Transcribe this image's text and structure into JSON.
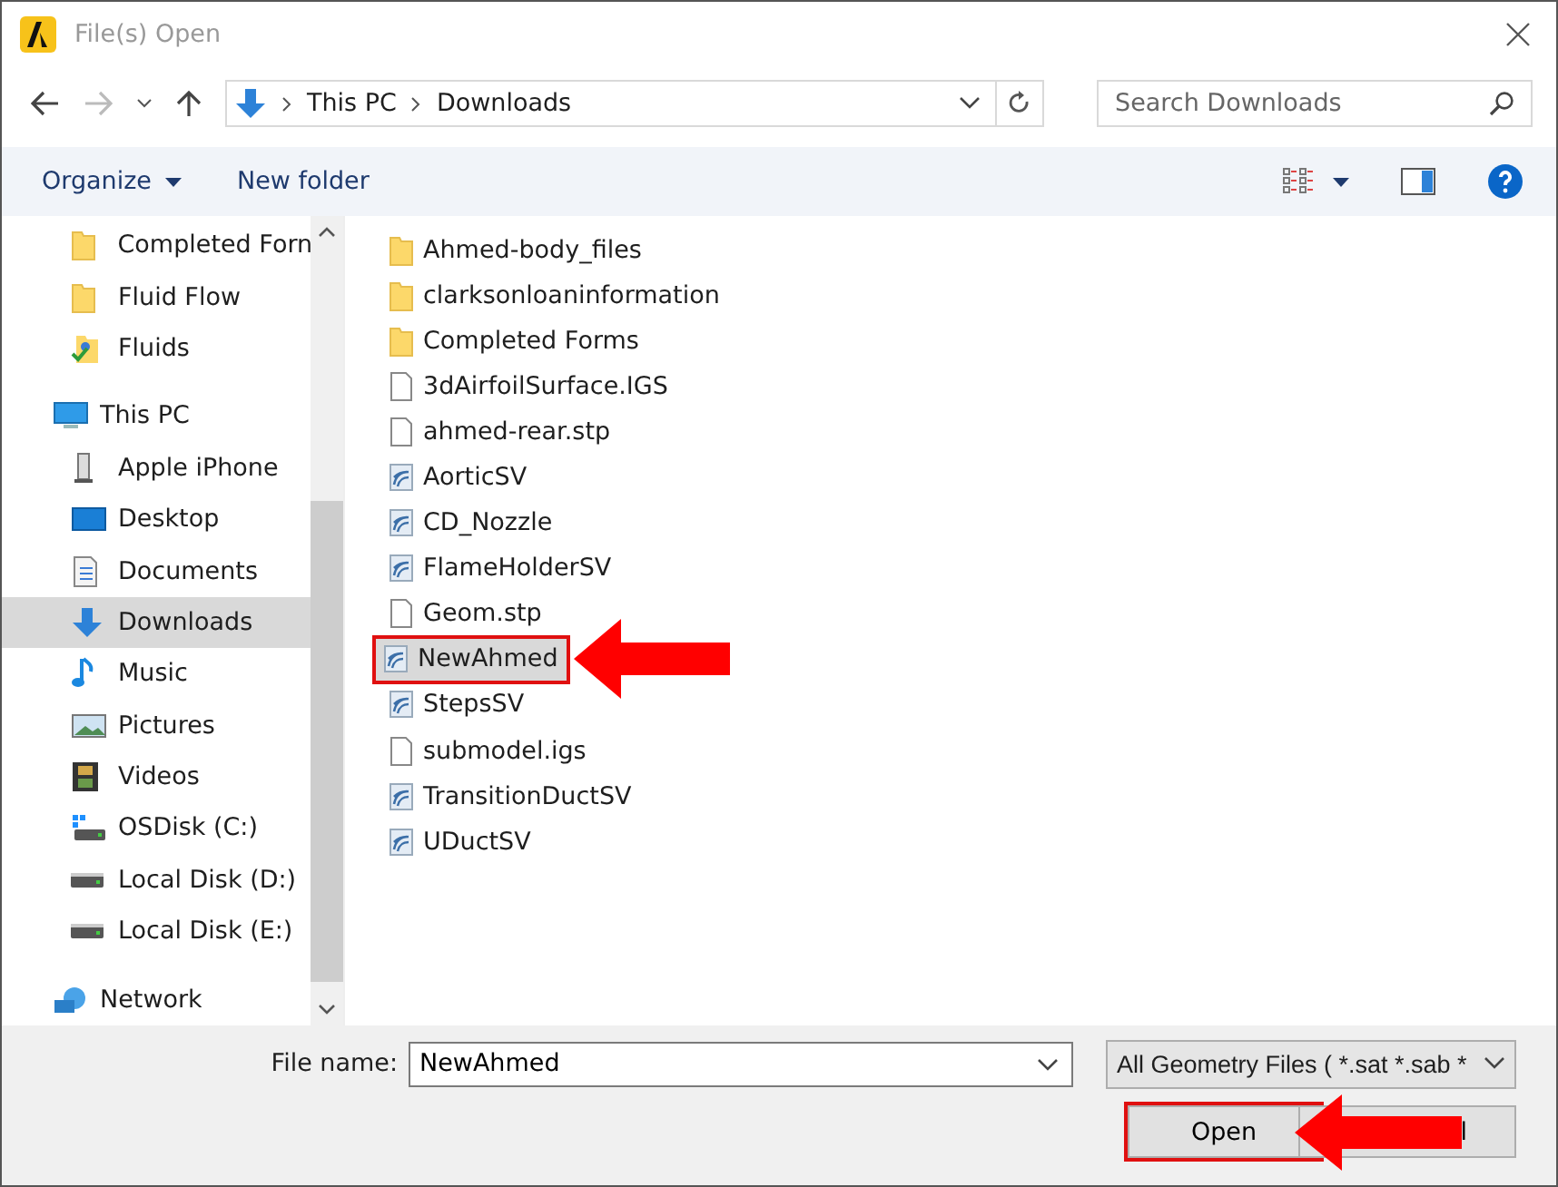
{
  "window": {
    "title": "File(s) Open"
  },
  "address_bar": {
    "path": [
      "This PC",
      "Downloads"
    ]
  },
  "search": {
    "placeholder": "Search Downloads"
  },
  "toolbar": {
    "organize": "Organize",
    "new_folder": "New folder"
  },
  "sidebar": {
    "quick_access_items": [
      {
        "label": "Completed Forn",
        "kind": "folder",
        "selected": false
      },
      {
        "label": "Fluid Flow",
        "kind": "folder",
        "selected": false
      },
      {
        "label": "Fluids",
        "kind": "shared-folder",
        "selected": false
      }
    ],
    "items": [
      {
        "label": "This PC",
        "kind": "pc",
        "selected": false,
        "children": [
          {
            "label": "Apple iPhone",
            "kind": "phone",
            "selected": false
          },
          {
            "label": "Desktop",
            "kind": "desktop",
            "selected": false
          },
          {
            "label": "Documents",
            "kind": "documents",
            "selected": false
          },
          {
            "label": "Downloads",
            "kind": "downloads",
            "selected": true
          },
          {
            "label": "Music",
            "kind": "music",
            "selected": false
          },
          {
            "label": "Pictures",
            "kind": "pictures",
            "selected": false
          },
          {
            "label": "Videos",
            "kind": "videos",
            "selected": false
          },
          {
            "label": "OSDisk (C:)",
            "kind": "os-disk",
            "selected": false
          },
          {
            "label": "Local Disk (D:)",
            "kind": "disk",
            "selected": false
          },
          {
            "label": "Local Disk (E:)",
            "kind": "disk",
            "selected": false
          }
        ]
      },
      {
        "label": "Network",
        "kind": "network",
        "selected": false
      }
    ]
  },
  "files": [
    {
      "name": "Ahmed-body_files",
      "kind": "folder",
      "selected": false
    },
    {
      "name": "clarksonloaninformation",
      "kind": "folder",
      "selected": false
    },
    {
      "name": "Completed Forms",
      "kind": "folder",
      "selected": false
    },
    {
      "name": "3dAirfoilSurface.IGS",
      "kind": "file",
      "selected": false
    },
    {
      "name": "ahmed-rear.stp",
      "kind": "file",
      "selected": false
    },
    {
      "name": "AorticSV",
      "kind": "model",
      "selected": false
    },
    {
      "name": "CD_Nozzle",
      "kind": "model",
      "selected": false
    },
    {
      "name": "FlameHolderSV",
      "kind": "model",
      "selected": false
    },
    {
      "name": "Geom.stp",
      "kind": "file",
      "selected": false
    },
    {
      "name": "NewAhmed",
      "kind": "model",
      "selected": true
    },
    {
      "name": "StepsSV",
      "kind": "model",
      "selected": false
    },
    {
      "name": "submodel.igs",
      "kind": "file",
      "selected": false
    },
    {
      "name": "TransitionDuctSV",
      "kind": "model",
      "selected": false
    },
    {
      "name": "UDuctSV",
      "kind": "model",
      "selected": false
    }
  ],
  "footer": {
    "file_name_label": "File name:",
    "file_name": "NewAhmed",
    "file_type": "All Geometry Files ( *.sat *.sab *",
    "open_button": "Open",
    "cancel_button": "l"
  }
}
